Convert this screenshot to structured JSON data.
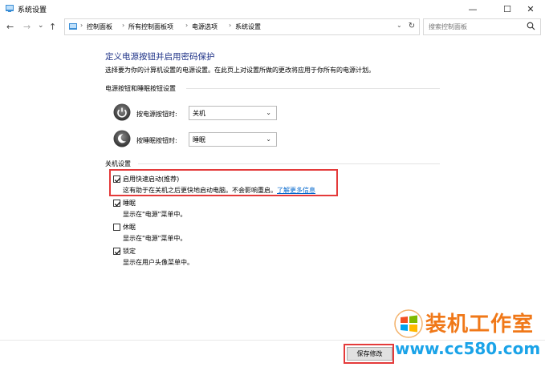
{
  "window": {
    "title": "系统设置",
    "controls": {
      "minimize": "—",
      "maximize": "☐",
      "close": "✕"
    }
  },
  "nav": {
    "back": "←",
    "forward": "→",
    "recent": "⌄",
    "up": "↑",
    "breadcrumbs": [
      "控制面板",
      "所有控制面板项",
      "电源选项",
      "系统设置"
    ],
    "separator": "›",
    "refresh": "↻",
    "search_placeholder": "搜索控制面板"
  },
  "content": {
    "title": "定义电源按钮并启用密码保护",
    "description": "选择要为你的计算机设置的电源设置。在此页上对设置所做的更改将应用于你所有的电源计划。",
    "buttons_section": {
      "heading": "电源按钮和睡眠按钮设置",
      "power_button_label": "按电源按钮时:",
      "power_button_value": "关机",
      "sleep_button_label": "按睡眠按钮时:",
      "sleep_button_value": "睡眠"
    },
    "shutdown_section": {
      "heading": "关机设置",
      "items": [
        {
          "label": "启用快速启动(推荐)",
          "desc": "这有助于在关机之后更快地启动电脑。不会影响重启。",
          "link": "了解更多信息",
          "checked": true
        },
        {
          "label": "睡眠",
          "desc": "显示在\"电源\"菜单中。",
          "checked": true
        },
        {
          "label": "休眠",
          "desc": "显示在\"电源\"菜单中。",
          "checked": false
        },
        {
          "label": "锁定",
          "desc": "显示在用户头像菜单中。",
          "checked": true
        }
      ]
    }
  },
  "footer": {
    "save_label": "保存修改"
  },
  "watermark": {
    "brand": "装机工作室",
    "url": "www.cc580.com"
  },
  "colors": {
    "title_blue": "#1e3287",
    "link_blue": "#0066cc",
    "highlight_red": "#e43a3a",
    "watermark_orange": "#f07818",
    "watermark_blue": "#1aa3e8"
  }
}
